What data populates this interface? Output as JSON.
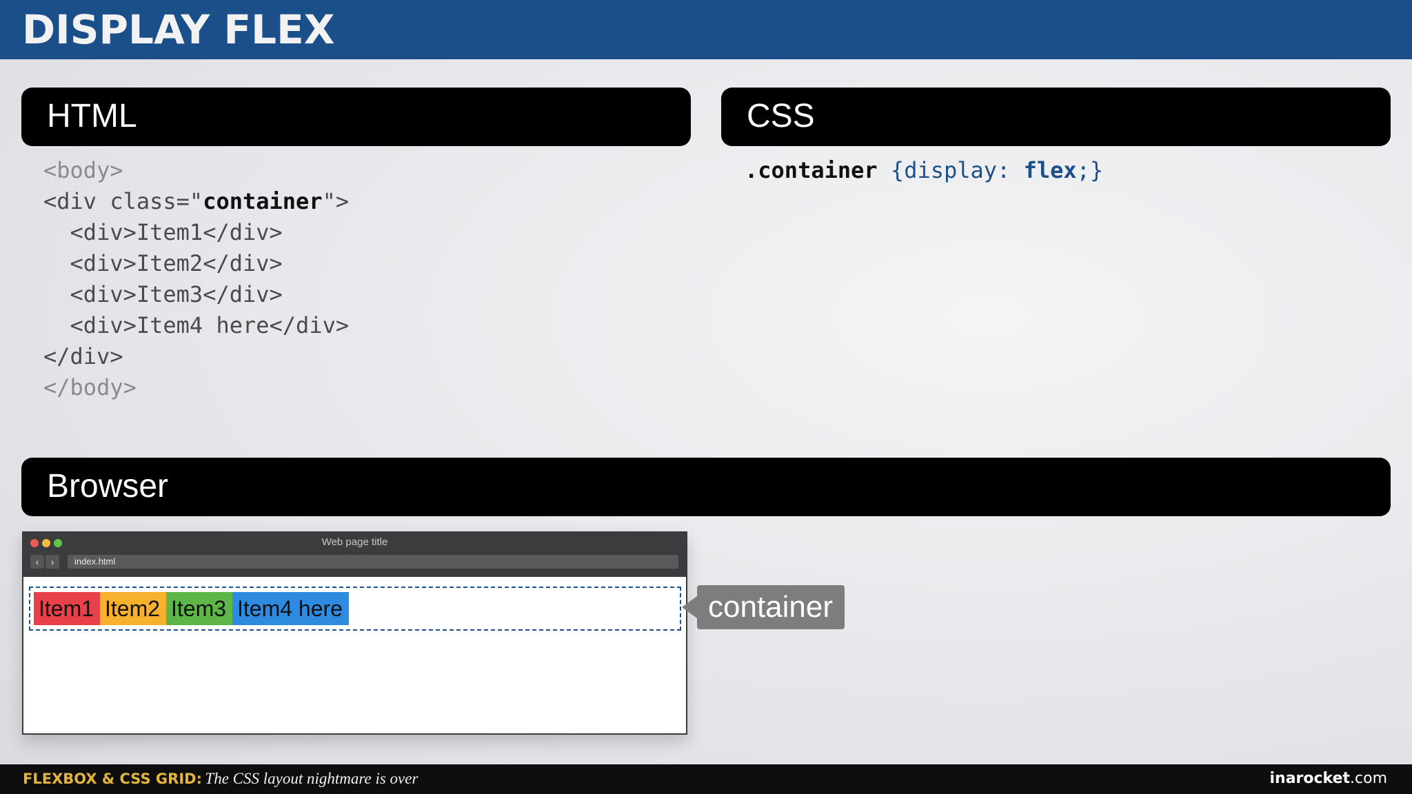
{
  "header": {
    "title": "DISPLAY FLEX"
  },
  "panels": {
    "html": "HTML",
    "css": "CSS",
    "browser": "Browser"
  },
  "html_code": {
    "line1": "<body>",
    "line2_pre": "<div class=\"",
    "line2_class": "container",
    "line2_post": "\">",
    "line3": "  <div>Item1</div>",
    "line4": "  <div>Item2</div>",
    "line5": "  <div>Item3</div>",
    "line6": "  <div>Item4 here</div>",
    "line7": "</div>",
    "line8": "</body>"
  },
  "css_code": {
    "selector": ".container",
    "open": " {display: ",
    "value": "flex",
    "close": ";}"
  },
  "browser": {
    "window_title": "Web page title",
    "url": "index.html",
    "back_icon": "chevron-left-icon",
    "forward_icon": "chevron-right-icon",
    "items": [
      "Item1",
      "Item2",
      "Item3",
      "Item4 here"
    ],
    "item_colors": [
      "#e8414a",
      "#f7b12c",
      "#5eb548",
      "#2f8be0"
    ]
  },
  "callout": {
    "label": "container"
  },
  "footer": {
    "course": "FLEXBOX & CSS GRID:",
    "subtitle": "The CSS layout nightmare is over",
    "brand_bold": "inarocket",
    "brand_rest": ".com"
  },
  "colors": {
    "header_bg": "#1b4f8a",
    "footer_accent": "#e3b53c"
  }
}
